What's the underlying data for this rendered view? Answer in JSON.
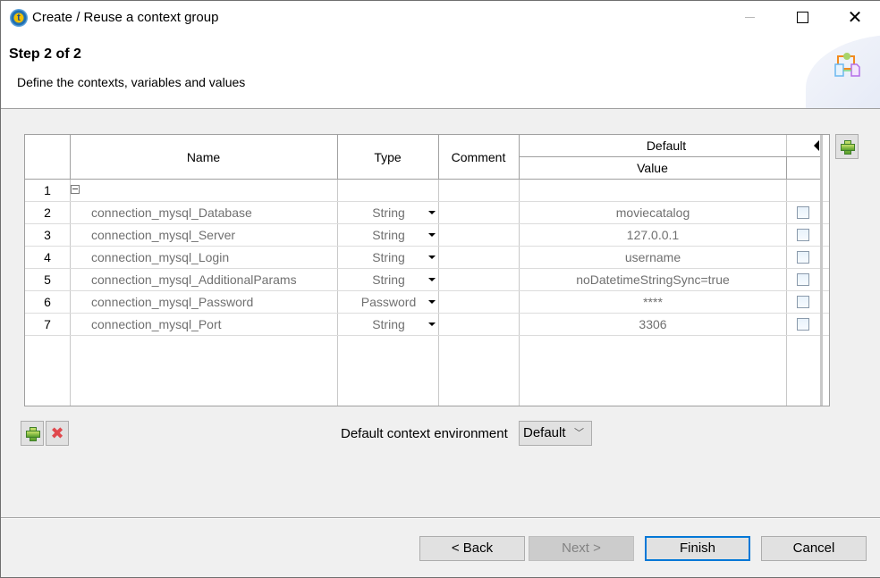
{
  "window": {
    "title": "Create / Reuse a context group",
    "icon": "talend-icon",
    "controls": [
      "minimize",
      "maximize",
      "close"
    ],
    "close_glyph": "✕"
  },
  "header": {
    "step_title": "Step 2 of 2",
    "description": "Define the contexts, variables and values",
    "icon": "context-group-wizard-icon"
  },
  "table": {
    "columns": {
      "name": "Name",
      "type": "Type",
      "comment": "Comment",
      "context_group": "Default",
      "value": "Value"
    },
    "group_row": {
      "num": "1",
      "toggle": "collapse"
    },
    "rows": [
      {
        "num": "2",
        "name": "connection_mysql_Database",
        "type": "String",
        "comment": "",
        "value": "moviecatalog",
        "checked": false
      },
      {
        "num": "3",
        "name": "connection_mysql_Server",
        "type": "String",
        "comment": "",
        "value": "127.0.0.1",
        "checked": false
      },
      {
        "num": "4",
        "name": "connection_mysql_Login",
        "type": "String",
        "comment": "",
        "value": "username",
        "checked": false
      },
      {
        "num": "5",
        "name": "connection_mysql_AdditionalParams",
        "type": "String",
        "comment": "",
        "value": "noDatetimeStringSync=true",
        "checked": false
      },
      {
        "num": "6",
        "name": "connection_mysql_Password",
        "type": "Password",
        "comment": "",
        "value": "****",
        "checked": false
      },
      {
        "num": "7",
        "name": "connection_mysql_Port",
        "type": "String",
        "comment": "",
        "value": "3306",
        "checked": false
      }
    ]
  },
  "controls": {
    "add_context_icon": "plus-icon",
    "add_variable_icon": "plus-icon",
    "remove_variable_icon": "x-icon",
    "x_glyph": "✖",
    "env_label": "Default context environment",
    "env_value": "Default",
    "env_chevron": "﹀"
  },
  "footer": {
    "back": "< Back",
    "next": "Next >",
    "finish": "Finish",
    "cancel": "Cancel"
  },
  "colors": {
    "accent": "#0078d7",
    "disabled_text": "#838383",
    "cell_text": "#707070",
    "remove_red": "#e0484c",
    "add_green": "#5aa02c"
  }
}
